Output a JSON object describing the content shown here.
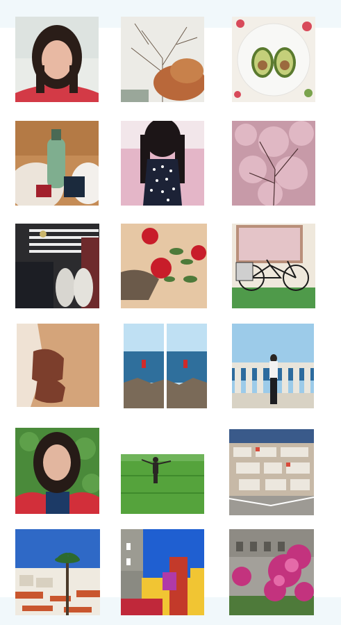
{
  "gallery": {
    "photos": [
      {
        "subject": "selfie-red-top"
      },
      {
        "subject": "autumn-tree-branches"
      },
      {
        "subject": "avocado-halves-plate"
      },
      {
        "subject": "drink-bottle-cozy-blanket"
      },
      {
        "subject": "polka-dot-top-pink-cardigan"
      },
      {
        "subject": "pink-blossom-tree"
      },
      {
        "subject": "outfit-flatlay-sneakers"
      },
      {
        "subject": "red-roses-in-hand"
      },
      {
        "subject": "bicycle-shop-window"
      },
      {
        "subject": "boots-on-wooden-floor"
      },
      {
        "subject": "girl-by-sea-rocks-diptych"
      },
      {
        "subject": "girl-at-balustrade-sea"
      },
      {
        "subject": "selfie-by-hedge"
      },
      {
        "subject": "person-in-green-field"
      },
      {
        "subject": "market-stalls-from-above"
      },
      {
        "subject": "city-rooftops-palm"
      },
      {
        "subject": "colorful-palace-towers"
      },
      {
        "subject": "bougainvillea-courtyard"
      }
    ]
  }
}
